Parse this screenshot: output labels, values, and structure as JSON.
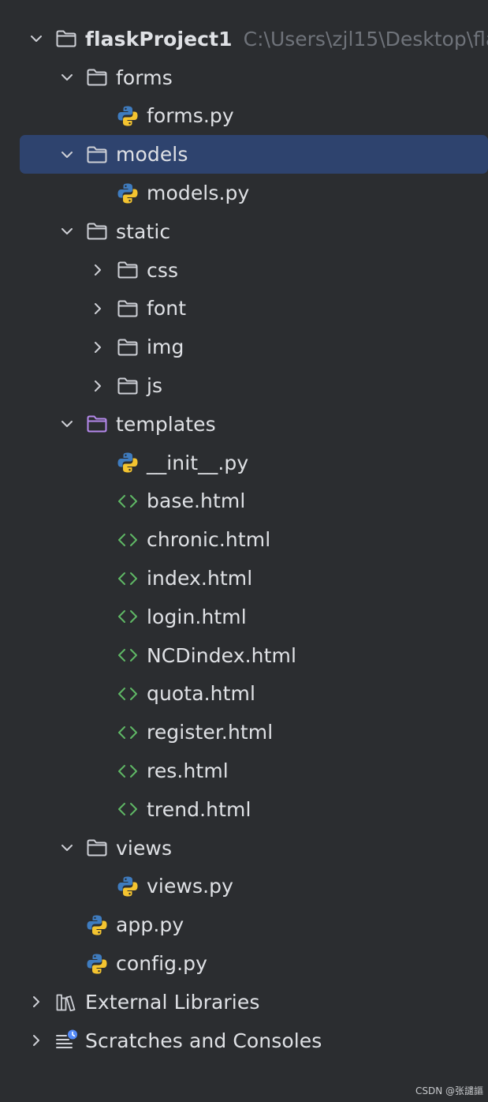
{
  "project": {
    "name": "flaskProject1",
    "path": "C:\\Users\\zjl15\\Desktop\\fla"
  },
  "nodes": [
    {
      "label": "forms",
      "type": "folder",
      "depth": 1,
      "state": "expanded"
    },
    {
      "label": "forms.py",
      "type": "python",
      "depth": 2,
      "state": "leaf"
    },
    {
      "label": "models",
      "type": "folder",
      "depth": 1,
      "state": "expanded",
      "selected": true
    },
    {
      "label": "models.py",
      "type": "python",
      "depth": 2,
      "state": "leaf"
    },
    {
      "label": "static",
      "type": "folder",
      "depth": 1,
      "state": "expanded"
    },
    {
      "label": "css",
      "type": "folder",
      "depth": 2,
      "state": "collapsed"
    },
    {
      "label": "font",
      "type": "folder",
      "depth": 2,
      "state": "collapsed"
    },
    {
      "label": "img",
      "type": "folder",
      "depth": 2,
      "state": "collapsed"
    },
    {
      "label": "js",
      "type": "folder",
      "depth": 2,
      "state": "collapsed"
    },
    {
      "label": "templates",
      "type": "template-folder",
      "depth": 1,
      "state": "expanded"
    },
    {
      "label": "__init__.py",
      "type": "python",
      "depth": 2,
      "state": "leaf"
    },
    {
      "label": "base.html",
      "type": "html",
      "depth": 2,
      "state": "leaf"
    },
    {
      "label": "chronic.html",
      "type": "html",
      "depth": 2,
      "state": "leaf"
    },
    {
      "label": "index.html",
      "type": "html",
      "depth": 2,
      "state": "leaf"
    },
    {
      "label": "login.html",
      "type": "html",
      "depth": 2,
      "state": "leaf"
    },
    {
      "label": "NCDindex.html",
      "type": "html",
      "depth": 2,
      "state": "leaf"
    },
    {
      "label": "quota.html",
      "type": "html",
      "depth": 2,
      "state": "leaf"
    },
    {
      "label": "register.html",
      "type": "html",
      "depth": 2,
      "state": "leaf"
    },
    {
      "label": "res.html",
      "type": "html",
      "depth": 2,
      "state": "leaf"
    },
    {
      "label": "trend.html",
      "type": "html",
      "depth": 2,
      "state": "leaf"
    },
    {
      "label": "views",
      "type": "folder",
      "depth": 1,
      "state": "expanded"
    },
    {
      "label": "views.py",
      "type": "python",
      "depth": 2,
      "state": "leaf"
    },
    {
      "label": "app.py",
      "type": "python",
      "depth": 1,
      "state": "leaf"
    },
    {
      "label": "config.py",
      "type": "python",
      "depth": 1,
      "state": "leaf"
    }
  ],
  "bottom_items": [
    {
      "label": "External Libraries",
      "type": "libraries"
    },
    {
      "label": "Scratches and Consoles",
      "type": "scratches"
    }
  ],
  "watermark": "CSDN @张譴謳",
  "colors": {
    "background": "#2b2d30",
    "selection": "#2e436e",
    "text": "#dfe1e5",
    "path": "#6f737a",
    "folder_outline": "#ced0d6",
    "template_folder_outline": "#b589ec",
    "html_icon": "#5fb865",
    "python_blue": "#3f7cbf",
    "python_yellow": "#f4c430",
    "chevron": "#ced0d6"
  }
}
